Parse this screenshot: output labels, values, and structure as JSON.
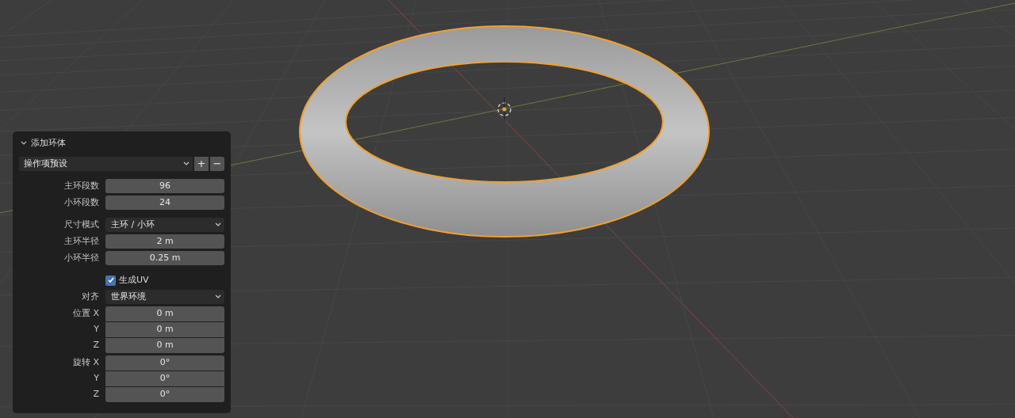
{
  "panel": {
    "title": "添加环体",
    "expanded": true,
    "preset": {
      "value": "操作项预设",
      "buttons": [
        "+",
        "−"
      ]
    },
    "groups": [
      {
        "rows": [
          {
            "kind": "number",
            "label": "主环段数",
            "value": "96"
          },
          {
            "kind": "number",
            "label": "小环段数",
            "value": "24"
          }
        ]
      },
      {
        "rows": [
          {
            "kind": "dropdown",
            "label": "尺寸模式",
            "value": "主环 / 小环"
          },
          {
            "kind": "number",
            "label": "主环半径",
            "value": "2 m"
          },
          {
            "kind": "number",
            "label": "小环半径",
            "value": "0.25 m"
          }
        ]
      },
      {
        "rows": [
          {
            "kind": "checkbox",
            "label": "生成UV",
            "checked": true
          },
          {
            "kind": "dropdown",
            "label": "对齐",
            "value": "世界环境"
          },
          {
            "kind": "vector",
            "label": "位置",
            "components": [
              {
                "axis": "X",
                "value": "0 m"
              },
              {
                "axis": "Y",
                "value": "0 m"
              },
              {
                "axis": "Z",
                "value": "0 m"
              }
            ]
          },
          {
            "kind": "vector",
            "label": "旋转",
            "components": [
              {
                "axis": "X",
                "value": "0°"
              },
              {
                "axis": "Y",
                "value": "0°"
              },
              {
                "axis": "Z",
                "value": "0°"
              }
            ]
          }
        ]
      }
    ]
  }
}
